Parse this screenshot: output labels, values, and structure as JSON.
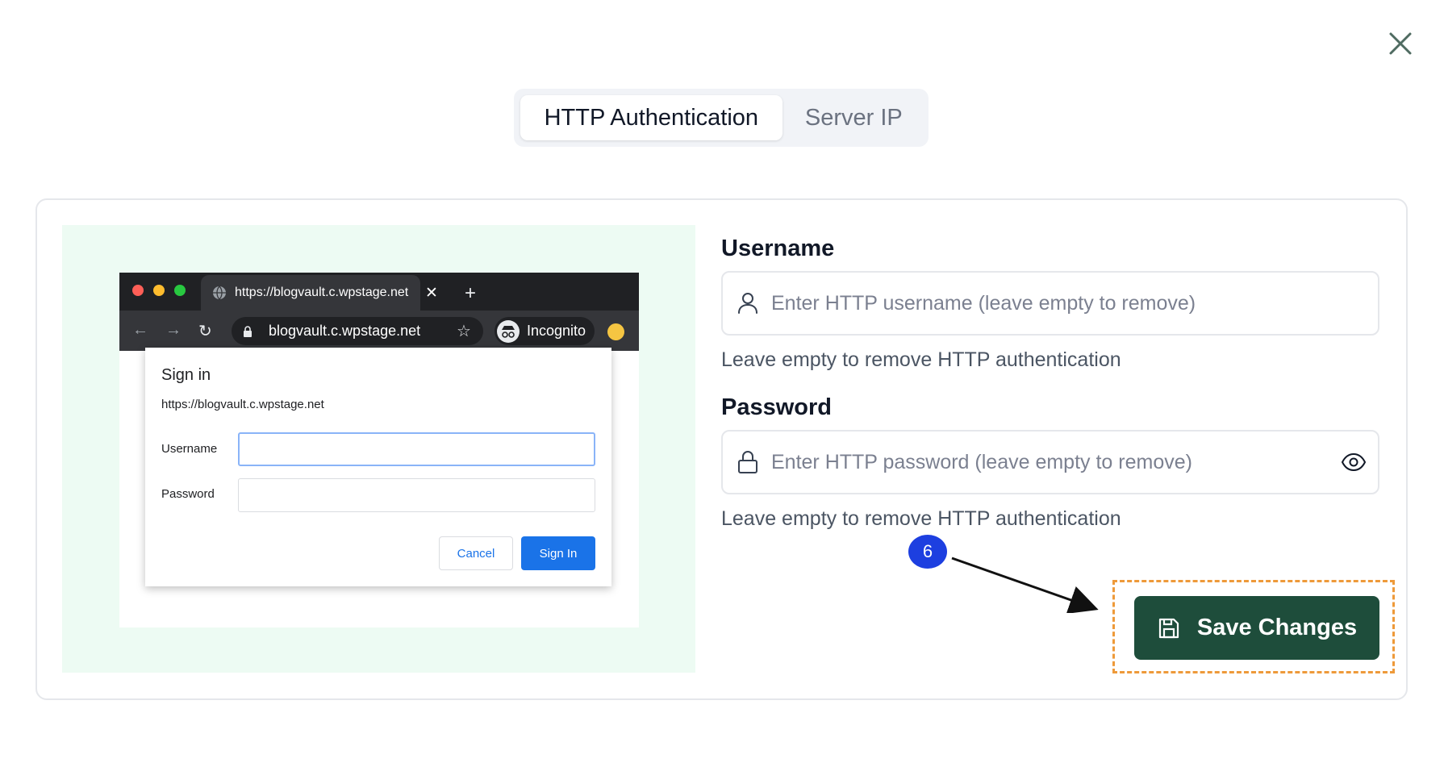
{
  "tabs": [
    {
      "label": "HTTP Authentication",
      "active": true
    },
    {
      "label": "Server IP",
      "active": false
    }
  ],
  "preview": {
    "browser_tab_title": "https://blogvault.c.wpstage.net",
    "omnibox_url": "blogvault.c.wpstage.net",
    "incognito_label": "Incognito",
    "dialog": {
      "title": "Sign in",
      "url": "https://blogvault.c.wpstage.net",
      "username_label": "Username",
      "password_label": "Password",
      "cancel_label": "Cancel",
      "signin_label": "Sign In"
    }
  },
  "form": {
    "username": {
      "label": "Username",
      "placeholder": "Enter HTTP username (leave empty to remove)",
      "value": "",
      "helper": "Leave empty to remove HTTP authentication",
      "icon": "user-icon"
    },
    "password": {
      "label": "Password",
      "placeholder": "Enter HTTP password (leave empty to remove)",
      "value": "",
      "helper": "Leave empty to remove HTTP authentication",
      "icon": "lock-icon",
      "toggle_icon": "eye-icon"
    },
    "save_label": "Save Changes",
    "save_icon": "save-icon"
  },
  "annotation": {
    "step_number": "6"
  },
  "colors": {
    "primary_button": "#1e4d3b",
    "preview_background": "#edfbf3",
    "annotation_badge": "#1d3fe0",
    "highlight_border": "#ee9a3a",
    "chrome_signin": "#1a73e8"
  }
}
